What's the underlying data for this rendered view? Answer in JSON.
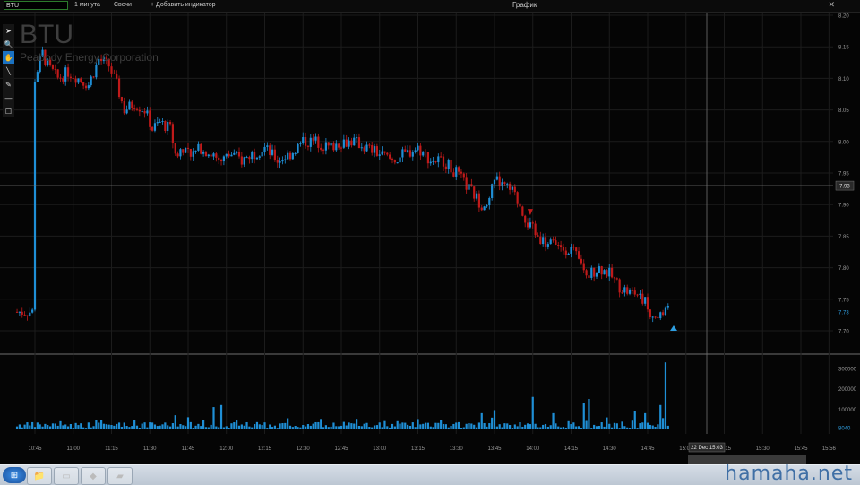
{
  "topbar": {
    "symbol": "BTU",
    "interval": "1 минута",
    "chart_style": "Свечи",
    "add_indicator": "+ Добавить индикатор",
    "window_title": "График",
    "close_glyph": "✕"
  },
  "toolbar": {
    "tools": [
      {
        "name": "select-arrow-icon",
        "glyph": "➤",
        "active": false
      },
      {
        "name": "zoom-icon",
        "glyph": "🔍",
        "active": false
      },
      {
        "name": "pan-hand-icon",
        "glyph": "✋",
        "active": true
      },
      {
        "name": "line-tool-icon",
        "glyph": "╲",
        "active": false
      },
      {
        "name": "pen-tool-icon",
        "glyph": "✎",
        "active": false
      },
      {
        "name": "horizontal-line-icon",
        "glyph": "—",
        "active": false
      },
      {
        "name": "rectangle-tool-icon",
        "glyph": "☐",
        "active": false
      }
    ]
  },
  "instrument": {
    "ticker": "BTU",
    "company": "Peabody Energy Corporation"
  },
  "chart_data": {
    "type": "candlestick",
    "price_axis": {
      "ticks": [
        "8.20",
        "8.15",
        "8.10",
        "8.05",
        "8.00",
        "7.95",
        "7.90",
        "7.85",
        "7.80",
        "7.75",
        "7.70"
      ],
      "range": [
        7.67,
        8.21
      ]
    },
    "time_axis": {
      "ticks": [
        "10:45",
        "11:00",
        "11:15",
        "11:30",
        "11:45",
        "12:00",
        "12:15",
        "12:30",
        "12:45",
        "13:00",
        "13:15",
        "13:30",
        "13:45",
        "14:00",
        "14:15",
        "14:30",
        "14:45",
        "15:00",
        "15:15",
        "15:30",
        "15:45",
        "15:56"
      ]
    },
    "price_path": [
      [
        "10:45",
        8.1
      ],
      [
        "10:48",
        8.14
      ],
      [
        "10:50",
        8.12
      ],
      [
        "10:54",
        8.1
      ],
      [
        "10:58",
        8.11
      ],
      [
        "11:02",
        8.1
      ],
      [
        "11:06",
        8.09
      ],
      [
        "11:10",
        8.13
      ],
      [
        "11:14",
        8.12
      ],
      [
        "11:17",
        8.09
      ],
      [
        "11:20",
        8.05
      ],
      [
        "11:24",
        8.06
      ],
      [
        "11:28",
        8.05
      ],
      [
        "11:31",
        8.02
      ],
      [
        "11:34",
        8.03
      ],
      [
        "11:38",
        8.02
      ],
      [
        "11:40",
        7.98
      ],
      [
        "11:43",
        7.99
      ],
      [
        "11:47",
        7.98
      ],
      [
        "11:50",
        7.99
      ],
      [
        "11:54",
        7.98
      ],
      [
        "11:58",
        7.97
      ],
      [
        "12:02",
        7.98
      ],
      [
        "12:06",
        7.97
      ],
      [
        "12:10",
        7.98
      ],
      [
        "12:15",
        7.99
      ],
      [
        "12:20",
        7.97
      ],
      [
        "12:25",
        7.98
      ],
      [
        "12:30",
        8.0
      ],
      [
        "12:35",
        8.0
      ],
      [
        "12:40",
        7.99
      ],
      [
        "12:45",
        8.0
      ],
      [
        "12:50",
        8.0
      ],
      [
        "12:55",
        7.99
      ],
      [
        "13:00",
        7.98
      ],
      [
        "13:05",
        7.97
      ],
      [
        "13:10",
        7.98
      ],
      [
        "13:15",
        7.99
      ],
      [
        "13:20",
        7.97
      ],
      [
        "13:25",
        7.97
      ],
      [
        "13:30",
        7.95
      ],
      [
        "13:34",
        7.93
      ],
      [
        "13:38",
        7.91
      ],
      [
        "13:42",
        7.89
      ],
      [
        "13:45",
        7.94
      ],
      [
        "13:48",
        7.93
      ],
      [
        "13:52",
        7.92
      ],
      [
        "13:55",
        7.9
      ],
      [
        "13:58",
        7.87
      ],
      [
        "14:02",
        7.85
      ],
      [
        "14:05",
        7.84
      ],
      [
        "14:10",
        7.83
      ],
      [
        "14:15",
        7.83
      ],
      [
        "14:18",
        7.81
      ],
      [
        "14:22",
        7.79
      ],
      [
        "14:26",
        7.8
      ],
      [
        "14:30",
        7.79
      ],
      [
        "14:34",
        7.77
      ],
      [
        "14:38",
        7.76
      ],
      [
        "14:42",
        7.76
      ],
      [
        "14:46",
        7.73
      ],
      [
        "14:49",
        7.72
      ],
      [
        "14:52",
        7.73
      ]
    ],
    "last_price_label": "7.73",
    "crosshair_price_label": "7.93",
    "crosshair_time_label": "22 Dec 15:03",
    "volume_axis": {
      "ticks": [
        "300000",
        "200000",
        "100000",
        "8040"
      ],
      "range": [
        0,
        330000
      ]
    },
    "volume_spikes": [
      [
        "11:40",
        70000
      ],
      [
        "11:45",
        60000
      ],
      [
        "11:55",
        110000
      ],
      [
        "11:58",
        120000
      ],
      [
        "13:40",
        80000
      ],
      [
        "13:45",
        95000
      ],
      [
        "14:00",
        160000
      ],
      [
        "14:08",
        80000
      ],
      [
        "14:20",
        130000
      ],
      [
        "14:22",
        150000
      ],
      [
        "14:40",
        90000
      ],
      [
        "14:44",
        80000
      ],
      [
        "14:50",
        120000
      ],
      [
        "14:52",
        330000
      ]
    ],
    "colors": {
      "up": "#1f8fd6",
      "down": "#c01a1a",
      "grid": "#1c1c1c",
      "axis_text": "#9a9a9a",
      "crosshair": "#707070"
    }
  },
  "taskbar": {
    "items": [
      {
        "name": "start-button-icon",
        "glyph": "⊞"
      },
      {
        "name": "file-explorer-icon",
        "glyph": "📁"
      },
      {
        "name": "blank-document-icon",
        "glyph": "▭"
      },
      {
        "name": "nvidia-app-icon",
        "glyph": "◆"
      },
      {
        "name": "trading-app-icon",
        "glyph": "▰"
      }
    ]
  },
  "watermark": "hamaha.net"
}
